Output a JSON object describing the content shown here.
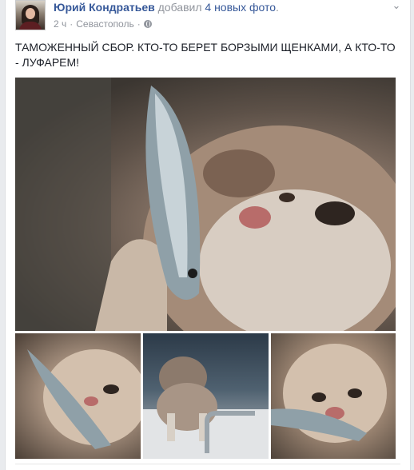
{
  "post": {
    "author": "Юрий Кондратьев",
    "action_prefix": "добавил",
    "action_link": "4 новых фото",
    "action_suffix": ".",
    "time": "2 ч",
    "separator": "·",
    "location": "Севастополь",
    "meta_dot": "·",
    "text": "ТАМОЖЕННЫЙ СБОР. КТО-ТО БЕРЕТ БОРЗЫМИ ЩЕНКАМИ, А КТО-ТО - ЛУФАРЕМ!",
    "icons": [
      "avatar-photo",
      "globe-icon",
      "chevron-down-icon"
    ],
    "photos": [
      {
        "description_icon": "cat-with-fish-photo"
      },
      {
        "description_icon": "cat-with-fish-photo"
      },
      {
        "description_icon": "cat-on-boat-photo"
      },
      {
        "description_icon": "cat-with-fish-photo"
      }
    ]
  },
  "colors": {
    "link": "#365899",
    "meta": "#90949c",
    "text": "#1d2129",
    "page_bg": "#e9ebee"
  }
}
